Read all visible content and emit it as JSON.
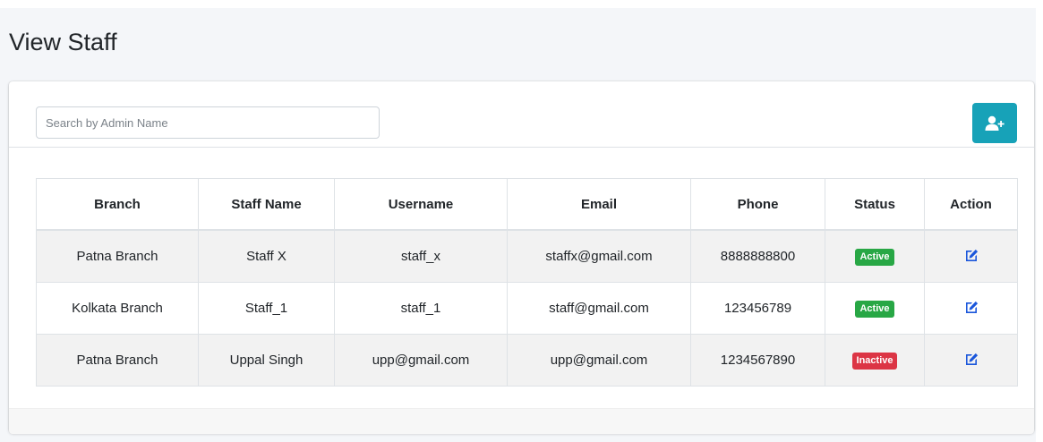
{
  "page": {
    "title": "View Staff"
  },
  "search": {
    "placeholder": "Search by Admin Name",
    "value": ""
  },
  "toolbar": {
    "add_icon": "user-plus-icon",
    "accent": "#17a2b8"
  },
  "table": {
    "columns": [
      "Branch",
      "Staff Name",
      "Username",
      "Email",
      "Phone",
      "Status",
      "Action"
    ],
    "rows": [
      {
        "branch": "Patna Branch",
        "staff_name": "Staff X",
        "username": "staff_x",
        "email": "staffx@gmail.com",
        "phone": "8888888800",
        "status": "Active",
        "action_icon": "edit-icon"
      },
      {
        "branch": "Kolkata Branch",
        "staff_name": "Staff_1",
        "username": "staff_1",
        "email": "staff@gmail.com",
        "phone": "123456789",
        "status": "Active",
        "action_icon": "edit-icon"
      },
      {
        "branch": "Patna Branch",
        "staff_name": "Uppal Singh",
        "username": "upp@gmail.com",
        "email": "upp@gmail.com",
        "phone": "1234567890",
        "status": "Inactive",
        "action_icon": "edit-icon"
      }
    ]
  },
  "colors": {
    "active": "#28a745",
    "inactive": "#dc3545",
    "edit_icon": "#1a56db"
  }
}
